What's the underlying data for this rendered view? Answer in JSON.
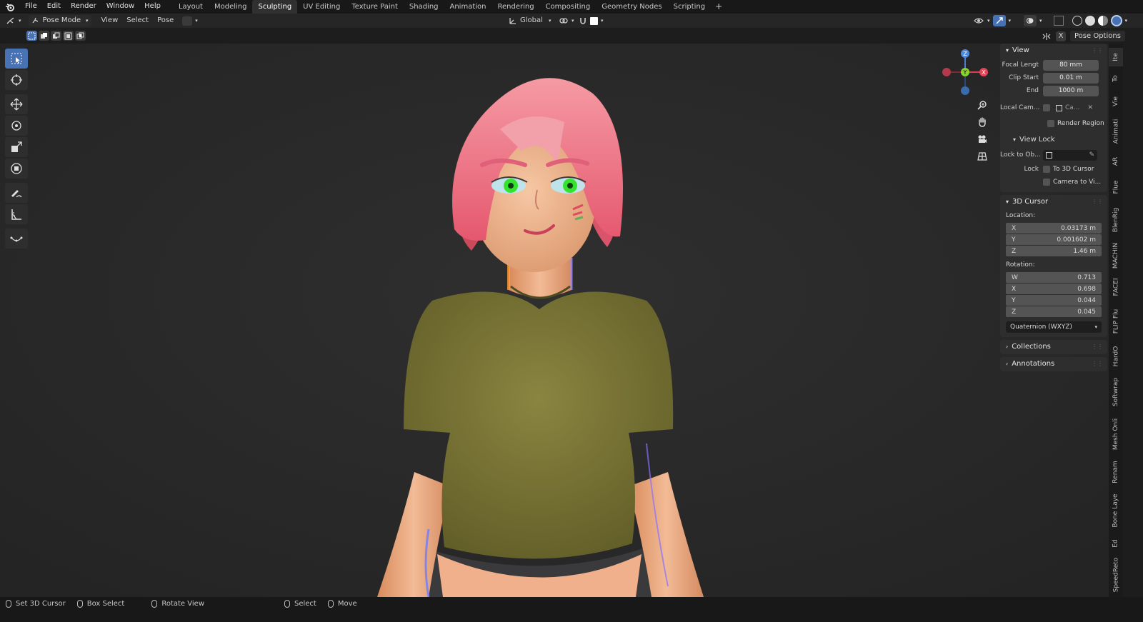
{
  "menu": [
    "File",
    "Edit",
    "Render",
    "Window",
    "Help"
  ],
  "workspaces": [
    "Layout",
    "Modeling",
    "Sculpting",
    "UV Editing",
    "Texture Paint",
    "Shading",
    "Animation",
    "Rendering",
    "Compositing",
    "Geometry Nodes",
    "Scripting"
  ],
  "workspace_add": "+",
  "header": {
    "mode": "Pose Mode",
    "view": "View",
    "select": "Select",
    "pose": "Pose",
    "transform_orientation": "Global",
    "pose_options": "Pose Options",
    "x_symmetry": "X"
  },
  "npanel": {
    "view": {
      "title": "View",
      "focal_label": "Focal Lengt",
      "focal_value": "80 mm",
      "clip_start_label": "Clip Start",
      "clip_start_value": "0.01 m",
      "end_label": "End",
      "end_value": "1000 m",
      "local_cam_label": "Local Cam...",
      "local_cam_value": "Ca...",
      "render_region": "Render Region",
      "view_lock": "View Lock",
      "lock_to_obj_label": "Lock to Ob...",
      "lock_label": "Lock",
      "to_3d_cursor": "To 3D Cursor",
      "camera_to_view": "Camera to Vi..."
    },
    "cursor": {
      "title": "3D Cursor",
      "location_label": "Location:",
      "loc": [
        {
          "axis": "X",
          "value": "0.03173 m"
        },
        {
          "axis": "Y",
          "value": "0.001602 m"
        },
        {
          "axis": "Z",
          "value": "1.46 m"
        }
      ],
      "rotation_label": "Rotation:",
      "rot": [
        {
          "axis": "W",
          "value": "0.713"
        },
        {
          "axis": "X",
          "value": "0.698"
        },
        {
          "axis": "Y",
          "value": "0.044"
        },
        {
          "axis": "Z",
          "value": "0.045"
        }
      ],
      "rotation_mode": "Quaternion (WXYZ)"
    },
    "collections": "Collections",
    "annotations": "Annotations"
  },
  "side_tabs": [
    "Ite",
    "To",
    "Vie",
    "Animati",
    "AR",
    "Flue",
    "BlenRig",
    "MACHIN",
    "FACEI",
    "FLIP Flu",
    "HardO",
    "Softwrap",
    "Mesh Onli",
    "Renam",
    "Bone Laye",
    "Ed",
    "SpeedReto"
  ],
  "gizmo": {
    "z": "Z",
    "y": "Y",
    "x": "X"
  },
  "status": {
    "set_cursor": "Set 3D Cursor",
    "box_select": "Box Select",
    "rotate_view": "Rotate View",
    "select": "Select",
    "move": "Move"
  },
  "colors": {
    "accent": "#4772b3",
    "shirt": "#6e6a30",
    "hair": "#ef7a8a",
    "skin": "#f0b38e",
    "eyes": "#2ee02a"
  }
}
